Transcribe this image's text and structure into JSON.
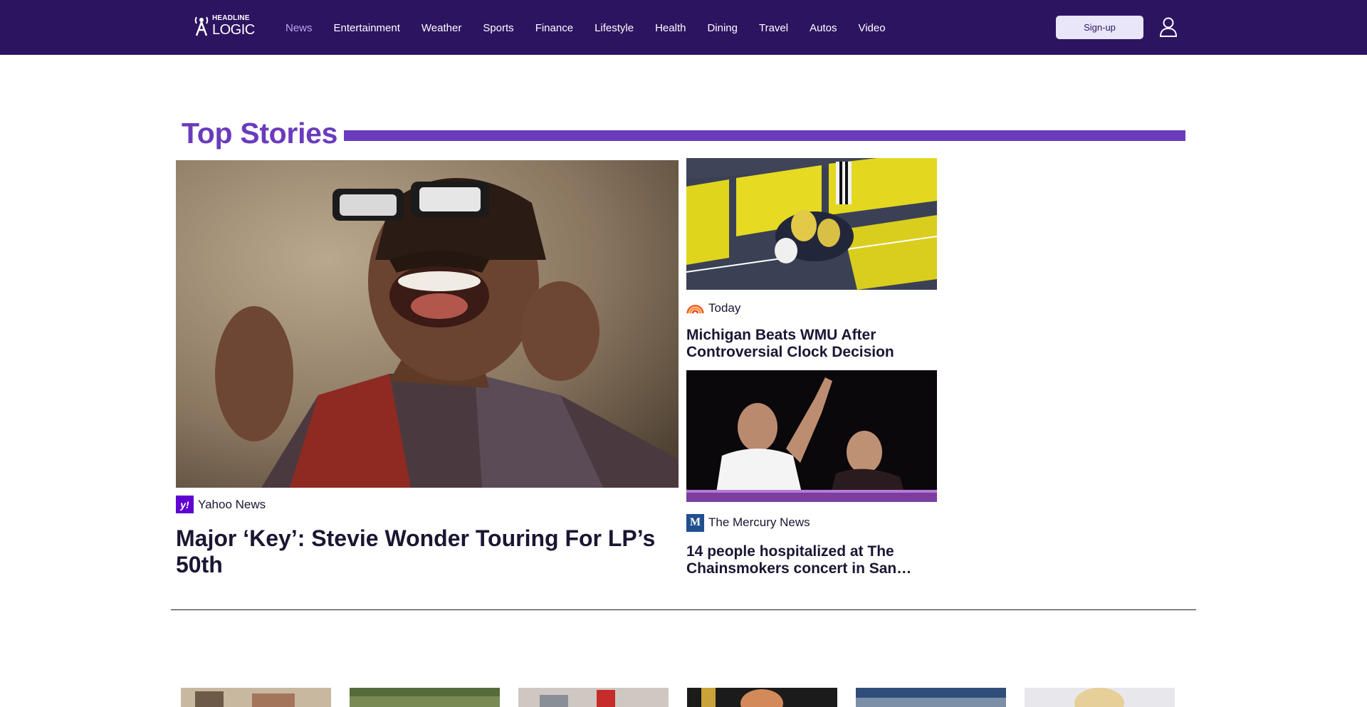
{
  "brand": {
    "logo_top": "HEADLINE",
    "logo_bottom": "LOGIC",
    "header_color": "#2d1461",
    "accent_color": "#6a3bbd",
    "active_nav_color": "#b9a6ee"
  },
  "nav": {
    "items": [
      {
        "label": "News",
        "active": true
      },
      {
        "label": "Entertainment",
        "active": false
      },
      {
        "label": "Weather",
        "active": false
      },
      {
        "label": "Sports",
        "active": false
      },
      {
        "label": "Finance",
        "active": false
      },
      {
        "label": "Lifestyle",
        "active": false
      },
      {
        "label": "Health",
        "active": false
      },
      {
        "label": "Dining",
        "active": false
      },
      {
        "label": "Travel",
        "active": false
      },
      {
        "label": "Autos",
        "active": false
      },
      {
        "label": "Video",
        "active": false
      }
    ]
  },
  "account": {
    "signup_label": "Sign-up",
    "user_icon": "user-icon"
  },
  "top_stories": {
    "section_title": "Top Stories",
    "main": {
      "source": "Yahoo News",
      "source_icon": "yahoo-logo-icon",
      "headline": "Major ‘Key’: Stevie Wonder Touring For LP’s 50th",
      "image": "stevie-wonder-photo"
    },
    "side": [
      {
        "source": "Today",
        "source_icon": "today-rainbow-icon",
        "headline": "Michigan Beats WMU After Controversial Clock Decision",
        "image": "football-game-photo"
      },
      {
        "source": "The Mercury News",
        "source_icon": "mercury-news-logo-icon",
        "headline": "14 people hospitalized at The Chainsmokers concert in San…",
        "image": "chainsmokers-concert-photo"
      }
    ]
  },
  "more_stories": {
    "thumbnails": [
      "thumbnail-1",
      "thumbnail-2",
      "thumbnail-3",
      "thumbnail-4",
      "thumbnail-5",
      "thumbnail-6"
    ]
  }
}
